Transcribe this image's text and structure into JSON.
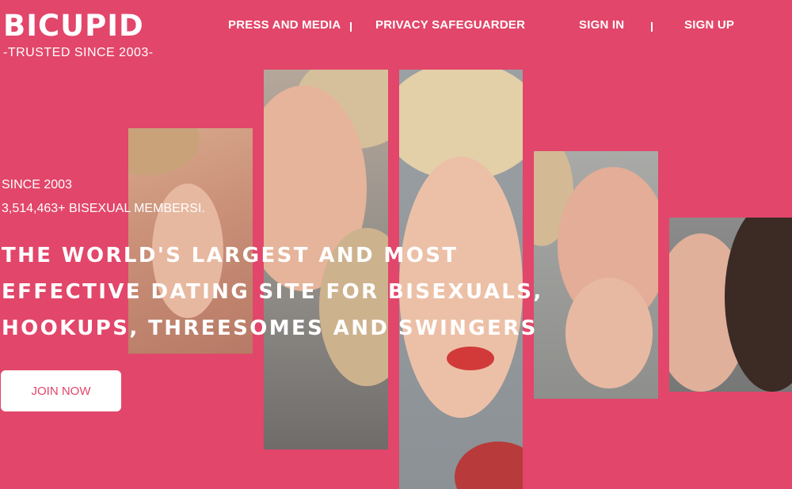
{
  "brand": {
    "name": "BICUPID",
    "tagline": "-TRUSTED SINCE 2003-"
  },
  "nav": {
    "press": "PRESS AND MEDIA",
    "privacy": "PRIVACY SAFEGUARDER",
    "sign_in": "SIGN IN",
    "sign_up": "SIGN UP"
  },
  "hero": {
    "since": "SINCE 2003",
    "members": "3,514,463+ BISEXUAL MEMBERSI.",
    "headline_lines": [
      "THE WORLD'S LARGEST AND MOST",
      "EFFECTIVE DATING SITE FOR BISEXUALS,",
      "HOOKUPS, THREESOMES AND SWINGERS"
    ],
    "cta": "JOIN NOW"
  },
  "colors": {
    "background": "#e2466a",
    "button_bg": "#ffffff",
    "button_text": "#e2466a"
  }
}
